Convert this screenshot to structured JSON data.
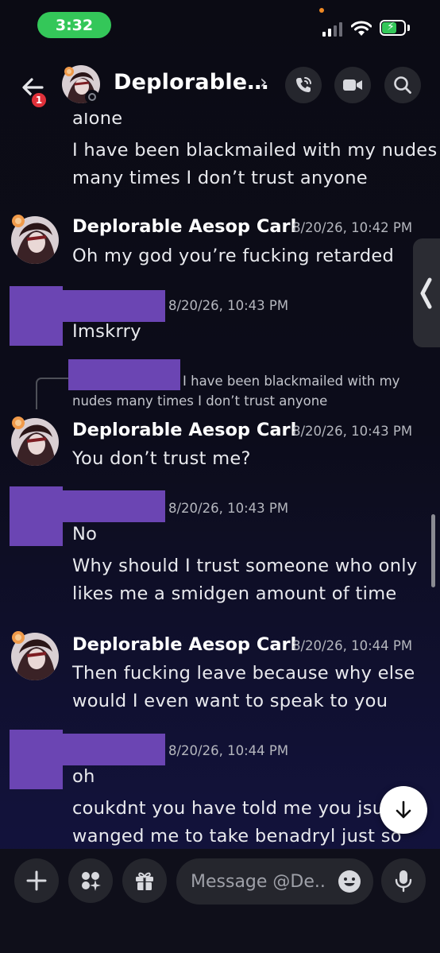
{
  "status_bar": {
    "time": "3:32"
  },
  "header": {
    "title": "Deplorable…",
    "chevron": "›",
    "badge_count": "1"
  },
  "chat": {
    "top_partial": "alone",
    "msg1_lines": [
      "I have been blackmailed with my nudes",
      "many times I don’t trust anyone"
    ],
    "group1": {
      "author": "Deplorable Aesop Carl",
      "timestamp": "8/20/26, 10:42 PM",
      "text": "Oh my god you’re fucking retarded"
    },
    "group2": {
      "timestamp": "8/20/26, 10:43 PM",
      "text": "Imskrry"
    },
    "reply": {
      "line1": "I have been blackmailed with my",
      "line2": "nudes many times I don’t trust anyone"
    },
    "group3": {
      "author": "Deplorable Aesop Carl",
      "timestamp": "8/20/26, 10:43 PM",
      "text": "You don’t trust me?"
    },
    "group4": {
      "timestamp": "8/20/26, 10:43 PM",
      "text": "No",
      "line2": "Why should I trust someone who only",
      "line3": "likes me a smidgen amount of time"
    },
    "group5": {
      "author": "Deplorable Aesop Carl",
      "timestamp": "8/20/26, 10:44 PM",
      "line1": "Then fucking leave because why else",
      "line2": "would I even want to speak to you"
    },
    "group6": {
      "timestamp": "8/20/26, 10:44 PM",
      "text": "oh",
      "line2": "coukdnt you have told me you jsut",
      "line3": "wanged me to take benadryl just so"
    }
  },
  "composer": {
    "placeholder": "Message @De.."
  },
  "icons": {
    "back": "arrow-left-icon",
    "call": "phone-icon",
    "video": "video-camera-icon",
    "search": "search-icon",
    "plus": "plus-icon",
    "apps": "apps-icon",
    "gift": "gift-icon",
    "emoji": "emoji-icon",
    "mic": "microphone-icon",
    "jump": "arrow-down-icon",
    "side": "chevron-left-icon"
  },
  "colors": {
    "accent_green": "#34c759",
    "redaction": "#6b45b3",
    "badge_red": "#e0313a"
  }
}
